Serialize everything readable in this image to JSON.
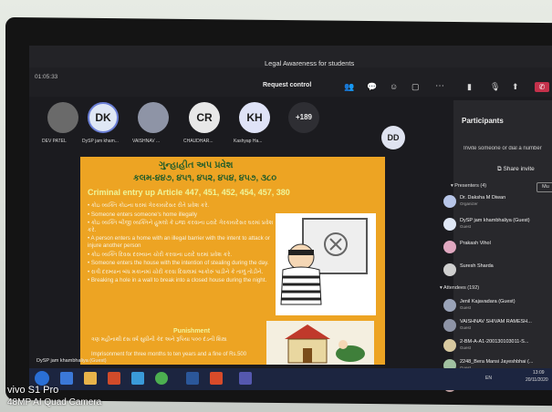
{
  "meeting": {
    "timer": "01:05:33",
    "title": "Legal Awareness for students",
    "request_control": "Request control"
  },
  "participants_row": [
    {
      "initials": "",
      "label": "DEV PATEL",
      "color": "#6a6a6a"
    },
    {
      "initials": "DK",
      "label": "DySP jam kham...",
      "color": "#dfe7f5"
    },
    {
      "initials": "",
      "label": "VAISHNAV ...",
      "color": "#8e94a6"
    },
    {
      "initials": "CR",
      "label": "CHAUDHAR...",
      "color": "#e8e8e8"
    },
    {
      "initials": "KH",
      "label": "Kashyap Ha...",
      "color": "#dfe3f7"
    },
    {
      "initials": "+189",
      "label": "",
      "color": "#2e2e33"
    }
  ],
  "dd_avatar": "DD",
  "slide": {
    "heading1": "ગુન્હાહીત અપ પ્રવેશ",
    "heading2": "કલમ-૪૪૭, ૪૫૧, ૪૫૨, ૪૫૪, ૪૫૭, ૩૮૦",
    "heading3": "Criminal entry up  Article 447, 451, 452, 454, 457, 380",
    "bullets": [
      "કોઇ વ્યક્તિ કોઇના ઘરમાં ગેરકાયદેસર રીતે પ્રવેશ કરે.",
      "Someone enters someone's home illegally",
      "કોઇ વ્યક્તિ બીજી વ્યક્તિને હુમલો કે ઇજા કરવાના ઇરાદે ગેરકાયદેસર ઘરમાં પ્રવેશ કરે.",
      "A person enters a home with an illegal barrier with the intent to attack or injure another person",
      "કોઇ વ્યક્તિ દિવસ દરમ્યાન ચોરી કરવાના ઇરાદે ઘરમાં પ્રવેશ કરે.",
      "Someone enters the house with the intention of stealing during the day.",
      "રાત્રી દરમ્યાન બંધ મકાનમાં ચોરી કરવા દિવાલમાં બાકોરું પાડીને કે તાળું તોડીને.",
      "Breaking a hole in a wall to break into a closed house during the night."
    ],
    "punishment_label": "Punishment",
    "punishment_gu": "ત્રણ મહીનાથી દસ વર્ષ સુધીની કેદ અને રૂપિયા ૫૦૦ દંડની શિક્ષા",
    "punishment_en": "Imprisonment for three months to ten years and a fine of Rs.500"
  },
  "presenter_label": "DySP jam khambhaliya (Guest)",
  "panel": {
    "title": "Participants",
    "invite": "Invite someone or dial a number",
    "share_invite": "Share invite",
    "presenters_header": "Presenters (4)",
    "mute_all": "Mu",
    "presenters": [
      {
        "name": "Dr. Daksha M Diwan",
        "sub": "Organizer",
        "color": "#b7c5e8"
      },
      {
        "name": "DySP jam khambhaliya (Guest)",
        "sub": "Guest",
        "color": "#dfe7f5"
      },
      {
        "name": "Prakash Vihol",
        "sub": "",
        "color": "#e0a8c0"
      },
      {
        "name": "Suresh Sharda",
        "sub": "",
        "color": "#cfcfcf"
      }
    ],
    "attendees_header": "Attendees (192)",
    "attendees": [
      {
        "name": "Jenil Kajavadara (Guest)",
        "sub": "Guest",
        "color": "#9aa3b8"
      },
      {
        "name": "VAISHNAV SHIVAM RAMESH...",
        "sub": "Guest",
        "color": "#8e94a6"
      },
      {
        "name": "2-BM-A-A1-200130103011-S...",
        "sub": "Guest",
        "color": "#d8c9a0"
      },
      {
        "name": "2248_Bera Mansi Jayeshbhai (...",
        "sub": "Guest",
        "color": "#a0c0a0"
      },
      {
        "name": "3-IC-(DD)-2021  Vallabh...",
        "sub": "",
        "color": "#c0a0a0"
      }
    ]
  },
  "taskbar": {
    "tray_lang": "EN",
    "tray_time": "13:09",
    "tray_date": "20/11/2020"
  },
  "watermark": {
    "line1": "vivo S1 Pro",
    "line2": "48MP AI Quad Camera"
  }
}
